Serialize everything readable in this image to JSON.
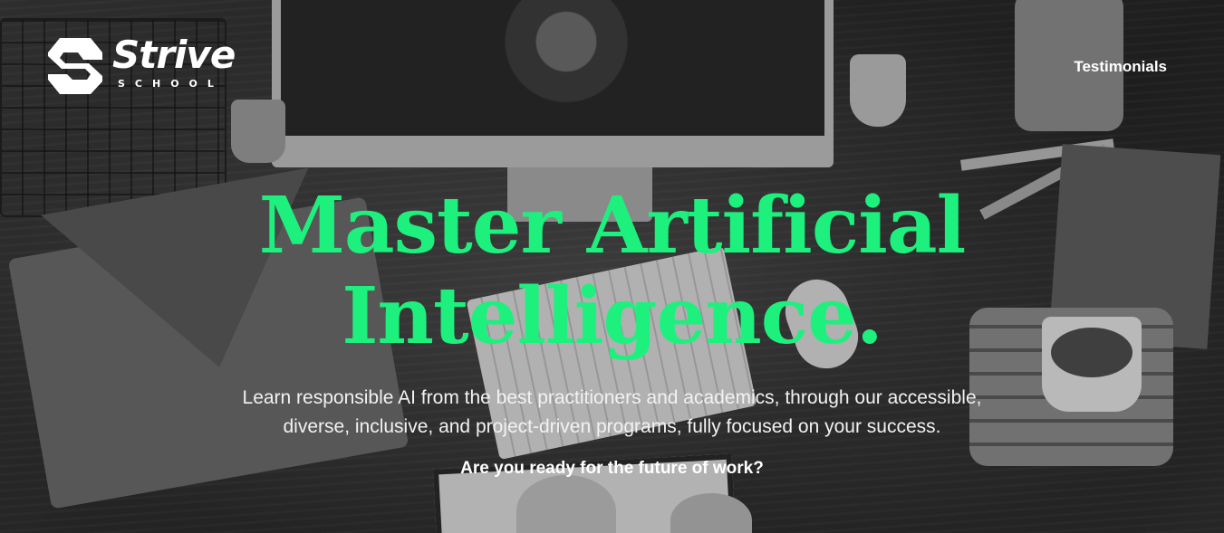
{
  "brand": {
    "name": "Strive",
    "subtitle": "SCHOOL"
  },
  "nav": {
    "testimonials_label": "Testimonials"
  },
  "hero": {
    "headline_line1": "Master Artificial",
    "headline_line2": "Intelligence.",
    "lede_line1": "Learn responsible AI from the best practitioners and academics, through our accessible,",
    "lede_line2": "diverse, inclusive, and project-driven programs, fully focused on your success.",
    "question": "Are you ready for the future of work?"
  },
  "colors": {
    "accent": "#1ef07e",
    "text": "#ffffff"
  },
  "icons": {
    "logo": "strive-logo-icon"
  }
}
